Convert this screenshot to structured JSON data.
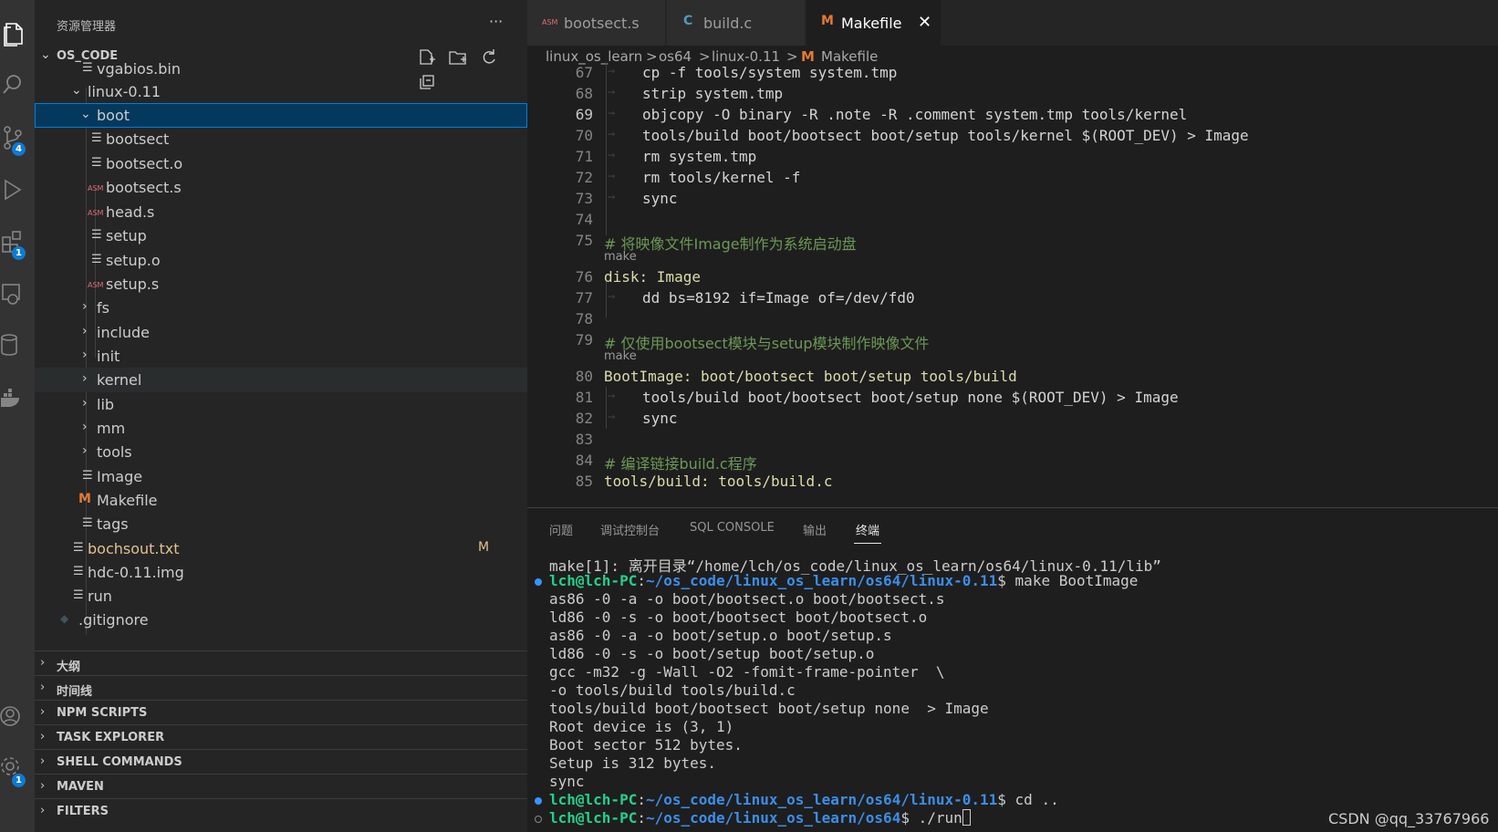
{
  "sidebar": {
    "title": "资源管理器",
    "more": "···",
    "project": "OS_CODE",
    "tree": [
      {
        "label": "vgabios.bin",
        "icon": "lines",
        "level": 3
      },
      {
        "label": "linux-0.11",
        "icon": "chevron-down",
        "level": 2
      },
      {
        "label": "boot",
        "icon": "chevron-down",
        "level": 3
      },
      {
        "label": "bootsect",
        "icon": "lines",
        "level": 4
      },
      {
        "label": "bootsect.o",
        "icon": "lines",
        "level": 4
      },
      {
        "label": "bootsect.s",
        "icon": "asm",
        "level": 4
      },
      {
        "label": "head.s",
        "icon": "asm",
        "level": 4
      },
      {
        "label": "setup",
        "icon": "lines",
        "level": 4
      },
      {
        "label": "setup.o",
        "icon": "lines",
        "level": 4
      },
      {
        "label": "setup.s",
        "icon": "asm",
        "level": 4
      },
      {
        "label": "fs",
        "icon": "chevron-right",
        "level": 3
      },
      {
        "label": "include",
        "icon": "chevron-right",
        "level": 3
      },
      {
        "label": "init",
        "icon": "chevron-right",
        "level": 3
      },
      {
        "label": "kernel",
        "icon": "chevron-right",
        "level": 3
      },
      {
        "label": "lib",
        "icon": "chevron-right",
        "level": 3
      },
      {
        "label": "mm",
        "icon": "chevron-right",
        "level": 3
      },
      {
        "label": "tools",
        "icon": "chevron-right",
        "level": 3
      },
      {
        "label": "Image",
        "icon": "lines",
        "level": 3
      },
      {
        "label": "Makefile",
        "icon": "makefile",
        "level": 3
      },
      {
        "label": "tags",
        "icon": "lines",
        "level": 3
      },
      {
        "label": "bochsout.txt",
        "icon": "lines",
        "level": 2,
        "badge": "M"
      },
      {
        "label": "hdc-0.11.img",
        "icon": "lines",
        "level": 2
      },
      {
        "label": "run",
        "icon": "lines",
        "level": 2
      },
      {
        "label": ".gitignore",
        "icon": "git",
        "level": 1
      }
    ],
    "sections": [
      "大纲",
      "时间线",
      "NPM SCRIPTS",
      "TASK EXPLORER",
      "SHELL COMMANDS",
      "MAVEN",
      "FILTERS"
    ]
  },
  "activity": {
    "scm_badge": "4",
    "ext_badge": "1",
    "settings_badge": "1"
  },
  "tabs": [
    {
      "label": "bootsect.s",
      "icon": "ASM"
    },
    {
      "label": "build.c",
      "icon": "C"
    },
    {
      "label": "Makefile",
      "icon": "M",
      "close": "✕"
    }
  ],
  "breadcrumb": [
    "linux_os_learn",
    ">",
    "os64",
    ">",
    "linux-0.11",
    ">",
    "M",
    "Makefile"
  ],
  "code": {
    "lines": [
      {
        "n": "67",
        "text": "cp -f tools/system system.tmp",
        "indent": true
      },
      {
        "n": "68",
        "text": "strip system.tmp",
        "indent": true
      },
      {
        "n": "69",
        "text": "objcopy -O binary -R .note -R .comment system.tmp tools/kernel",
        "indent": true
      },
      {
        "n": "70",
        "text": "tools/build boot/bootsect boot/setup tools/kernel $(ROOT_DEV) > Image",
        "indent": true
      },
      {
        "n": "71",
        "text": "rm system.tmp",
        "indent": true
      },
      {
        "n": "72",
        "text": "rm tools/kernel -f",
        "indent": true
      },
      {
        "n": "73",
        "text": "sync",
        "indent": true
      },
      {
        "n": "74",
        "text": "",
        "indent": false
      },
      {
        "n": "75",
        "text": "# 将映像文件Image制作为系统启动盘",
        "indent": false
      },
      {
        "n": "76",
        "text": "disk: Image",
        "indent": false
      },
      {
        "n": "77",
        "text": "dd bs=8192 if=Image of=/dev/fd0",
        "indent": true
      },
      {
        "n": "78",
        "text": "",
        "indent": false
      },
      {
        "n": "79",
        "text": "# 仅使用bootsect模块与setup模块制作映像文件",
        "indent": false
      },
      {
        "n": "80",
        "text": "BootImage: boot/bootsect boot/setup tools/build",
        "indent": false
      },
      {
        "n": "81",
        "text": "tools/build boot/bootsect boot/setup none $(ROOT_DEV) > Image",
        "indent": true
      },
      {
        "n": "82",
        "text": "sync",
        "indent": true
      },
      {
        "n": "83",
        "text": "",
        "indent": false
      },
      {
        "n": "84",
        "text": "# 编译链接build.c程序",
        "indent": false
      },
      {
        "n": "85",
        "text": "tools/build: tools/build.c",
        "indent": false
      }
    ],
    "codelens": "make"
  },
  "panel": {
    "tabs": [
      "问题",
      "调试控制台",
      "SQL CONSOLE",
      "输出",
      "终端"
    ],
    "terminal": [
      "make[1]: 离开目录“/home/lch/os_code/linux_os_learn/os64/linux-0.11/lib”",
      "as86 -0 -a -o boot/bootsect.o boot/bootsect.s",
      "ld86 -0 -s -o boot/bootsect boot/bootsect.o",
      "as86 -0 -a -o boot/setup.o boot/setup.s",
      "ld86 -0 -s -o boot/setup boot/setup.o",
      "gcc -m32 -g -Wall -O2 -fomit-frame-pointer  \\",
      "-o tools/build tools/build.c",
      "tools/build boot/bootsect boot/setup none  > Image",
      "Root device is (3, 1)",
      "Boot sector 512 bytes.",
      "Setup is 312 bytes.",
      "sync"
    ],
    "prompts": [
      {
        "user": "lch@lch-PC",
        "colon": ":",
        "path": "~/os_code/linux_os_learn/os64/linux-0.11",
        "cmd": "$ make BootImage"
      },
      {
        "user": "lch@lch-PC",
        "colon": ":",
        "path": "~/os_code/linux_os_learn/os64/linux-0.11",
        "cmd": "$ cd .."
      },
      {
        "user": "lch@lch-PC",
        "colon": ":",
        "path": "~/os_code/linux_os_learn/os64",
        "cmd": "$ ./run"
      }
    ]
  },
  "watermark": "CSDN @qq_33767966",
  "colors": {
    "accent": "#007fd4",
    "comment": "#6a9955",
    "terminal_user": "#23d18b",
    "terminal_path": "#3b8eea"
  }
}
